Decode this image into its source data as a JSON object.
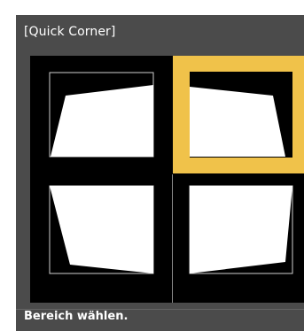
{
  "dialog": {
    "title": "[Quick Corner]",
    "status_text": "Bereich wählen."
  },
  "selection": {
    "selected_cell": "top-right",
    "highlight_color": "#f0c24a"
  },
  "cells": [
    {
      "id": "top-left",
      "label": "top-left-corner-option",
      "icon": "keystone-top-left-icon"
    },
    {
      "id": "top-right",
      "label": "top-right-corner-option",
      "icon": "keystone-top-right-icon"
    },
    {
      "id": "bottom-left",
      "label": "bottom-left-corner-option",
      "icon": "keystone-bottom-left-icon"
    },
    {
      "id": "bottom-right",
      "label": "bottom-right-corner-option",
      "icon": "keystone-bottom-right-icon"
    }
  ]
}
